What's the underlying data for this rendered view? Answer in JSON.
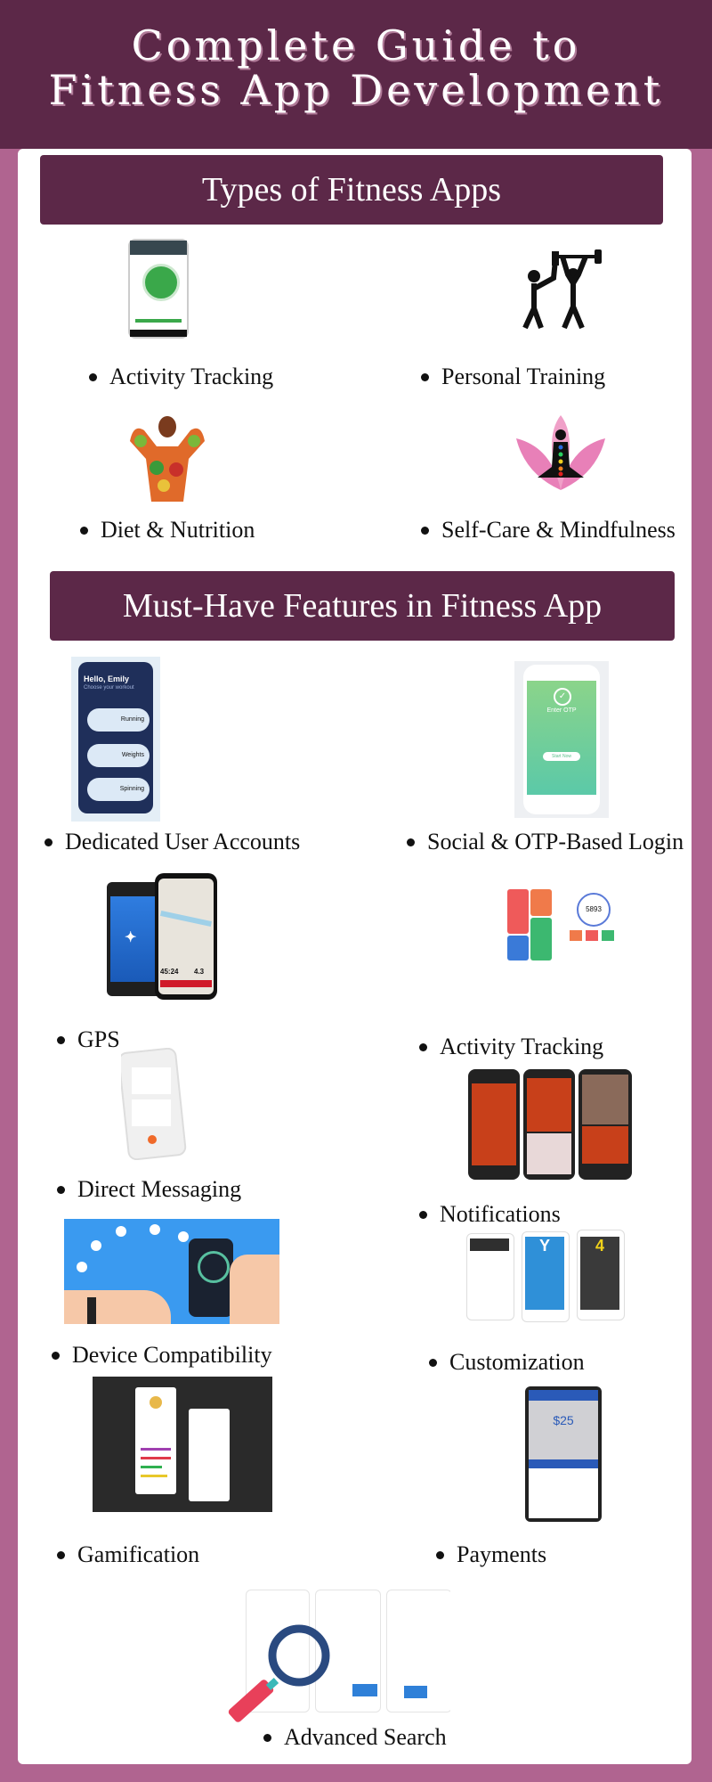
{
  "header": {
    "title_line1": "Complete Guide to",
    "title_line2": "Fitness App Development"
  },
  "sections": {
    "types": {
      "title": "Types of Fitness Apps",
      "items": [
        {
          "label": "Activity Tracking",
          "image": "activity-tracking-app-screenshot"
        },
        {
          "label": "Personal Training",
          "image": "personal-training-icon"
        },
        {
          "label": "Diet & Nutrition",
          "image": "vegetable-body-image"
        },
        {
          "label": "Self-Care & Mindfulness",
          "image": "meditation-lotus-image"
        }
      ]
    },
    "features": {
      "title": "Must-Have Features in Fitness App",
      "items": [
        {
          "label": "Dedicated User Accounts",
          "image": "user-account-app-screen",
          "greeting": "Hello, Emily",
          "sub": "Choose your workout",
          "workouts": [
            "Running",
            "Weights",
            "Spinning"
          ]
        },
        {
          "label": "Social & OTP-Based Login",
          "image": "otp-login-screen",
          "otp_title": "Enter OTP",
          "button": "Start Now"
        },
        {
          "label": "GPS",
          "image": "gps-map-screens",
          "time": "45:24",
          "distance": "4.3"
        },
        {
          "label": "Activity Tracking",
          "image": "activity-dashboard-screens",
          "steps": "5893"
        },
        {
          "label": "Direct Messaging",
          "image": "messaging-phone"
        },
        {
          "label": "Notifications",
          "image": "notification-phone-screens"
        },
        {
          "label": "Device Compatibility",
          "image": "smartwatch-phone-illustration"
        },
        {
          "label": "Customization",
          "image": "customized-app-screens"
        },
        {
          "label": "Gamification",
          "image": "gamification-screens"
        },
        {
          "label": "Payments",
          "image": "payment-screen",
          "amount": "$25"
        },
        {
          "label": "Advanced Search",
          "image": "search-magnifier-screens"
        }
      ]
    }
  },
  "colors": {
    "primary": "#5c2848",
    "border": "#b06490",
    "panel": "#ffffff"
  }
}
